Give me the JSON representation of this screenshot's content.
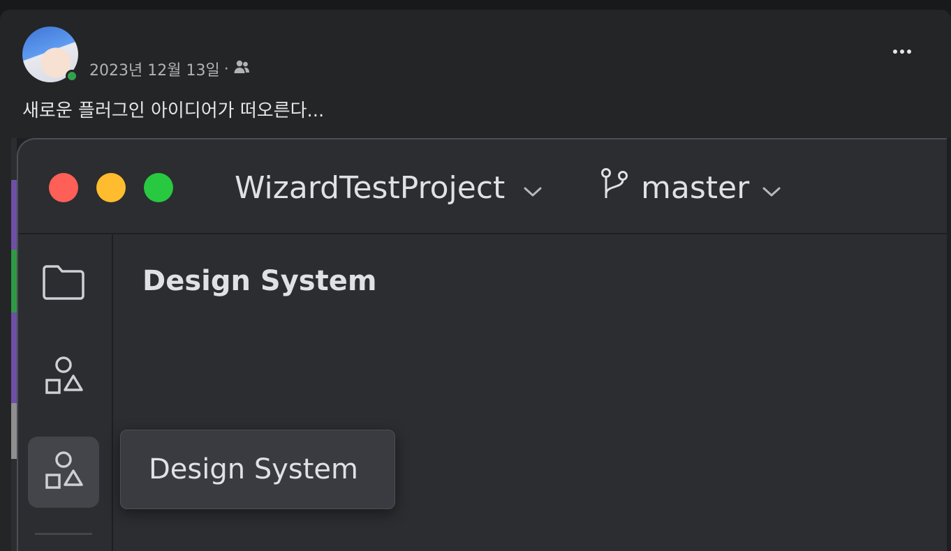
{
  "post": {
    "date": "2023년 12월 13일",
    "separator": "·",
    "audience_icon": "friends-icon",
    "text": "새로운 플러그인 아이디어가 떠오른다..."
  },
  "ide": {
    "project_name": "WizardTestProject",
    "branch_name": "master",
    "sidebar": [
      {
        "icon": "folder-icon"
      },
      {
        "icon": "shapes-icon"
      },
      {
        "icon": "shapes-icon",
        "active": true
      }
    ],
    "main_title": "Design System",
    "tooltip": "Design System"
  },
  "colors": {
    "page_bg": "#18191a",
    "card_bg": "#242526",
    "ide_bg": "#2b2d30",
    "traffic_red": "#fe5f57",
    "traffic_yellow": "#febc2e",
    "traffic_green": "#28c840",
    "online": "#31a24c"
  }
}
